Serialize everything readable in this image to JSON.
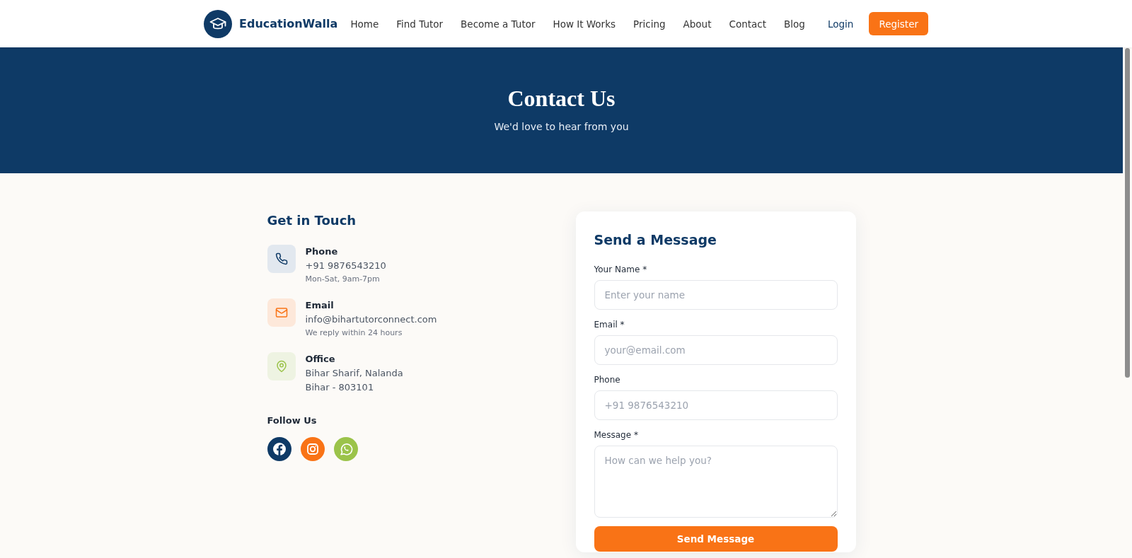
{
  "header": {
    "brand": "EducationWalla",
    "nav": [
      "Home",
      "Find Tutor",
      "Become a Tutor",
      "How It Works",
      "Pricing",
      "About",
      "Contact",
      "Blog"
    ],
    "login": "Login",
    "register": "Register"
  },
  "hero": {
    "title": "Contact Us",
    "subtitle": "We'd love to hear from you"
  },
  "contact": {
    "heading": "Get in Touch",
    "items": [
      {
        "kind": "phone",
        "label": "Phone",
        "lines": [
          "+91 9876543210"
        ],
        "note": "Mon-Sat, 9am-7pm"
      },
      {
        "kind": "email",
        "label": "Email",
        "lines": [
          "info@bihartutorconnect.com"
        ],
        "note": "We reply within 24 hours"
      },
      {
        "kind": "office",
        "label": "Office",
        "lines": [
          "Bihar Sharif, Nalanda",
          "Bihar - 803101"
        ]
      }
    ],
    "follow_heading": "Follow Us",
    "social": [
      {
        "kind": "facebook"
      },
      {
        "kind": "instagram"
      },
      {
        "kind": "whatsapp"
      }
    ]
  },
  "form": {
    "title": "Send a Message",
    "fields": [
      {
        "kind": "input",
        "label": "Your Name *",
        "placeholder": "Enter your name"
      },
      {
        "kind": "input",
        "label": "Email *",
        "placeholder": "your@email.com"
      },
      {
        "kind": "input",
        "label": "Phone",
        "placeholder": "+91 9876543210"
      },
      {
        "kind": "textarea",
        "label": "Message *",
        "placeholder": "How can we help you?"
      }
    ],
    "submit": "Send Message"
  }
}
